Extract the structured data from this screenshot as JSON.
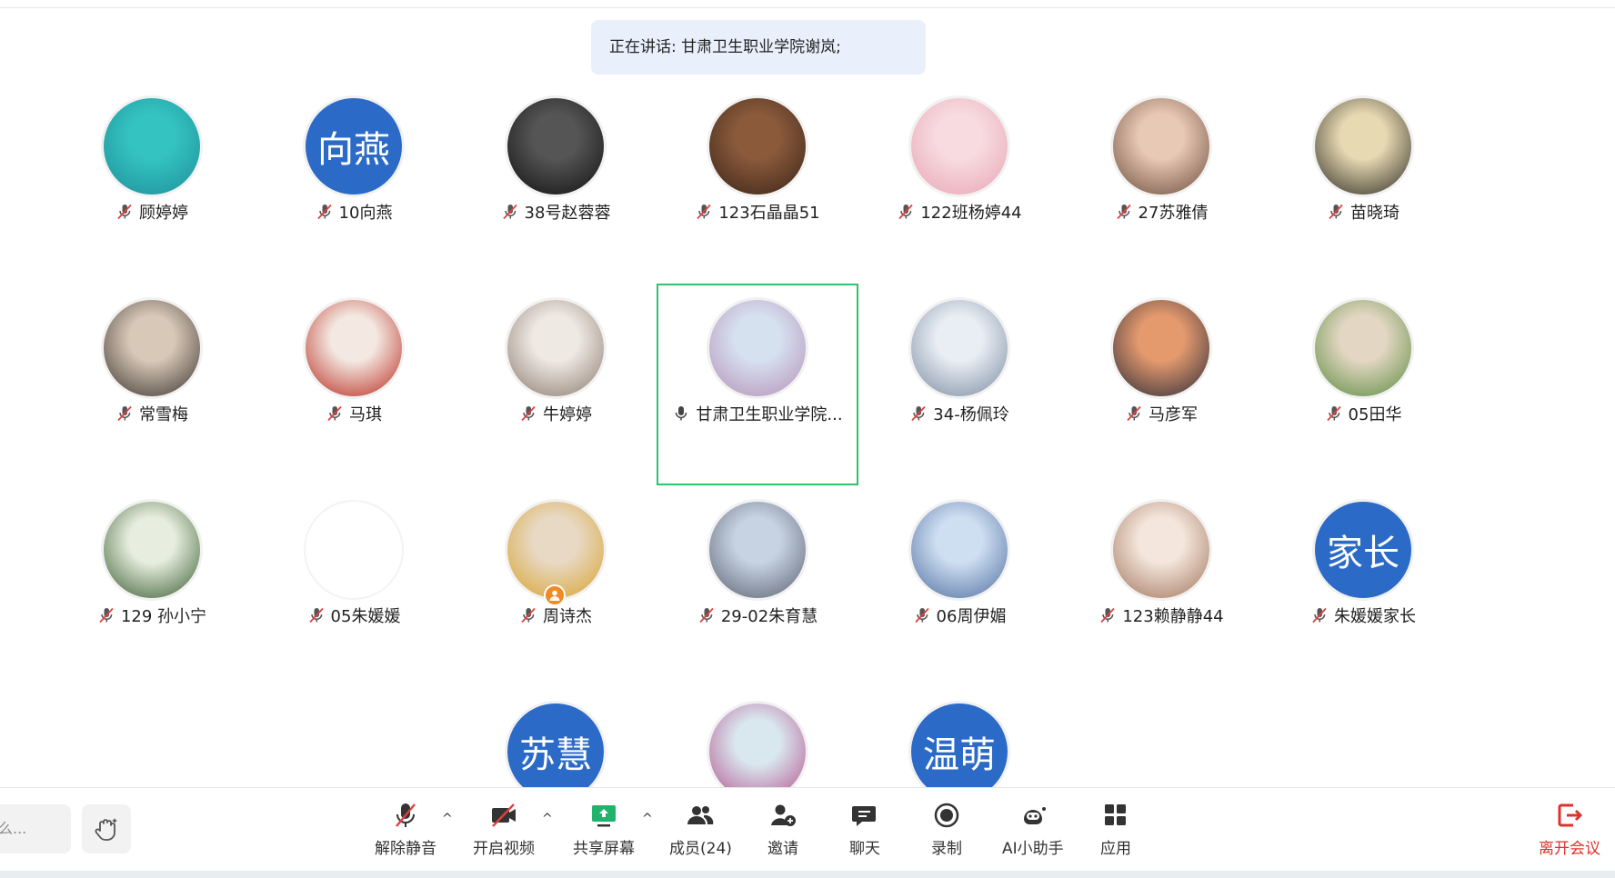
{
  "speaking_banner": "正在讲话: 甘肃卫生职业学院谢岚;",
  "participants": [
    {
      "name": "顾婷婷",
      "avatar_type": "photo",
      "colors": [
        "#34c3c0",
        "#1f8e9a"
      ],
      "muted": true
    },
    {
      "name": "10向燕",
      "avatar_type": "text",
      "avatar_text": "向燕",
      "muted": true
    },
    {
      "name": "38号赵蓉蓉",
      "avatar_type": "photo",
      "colors": [
        "#555555",
        "#111111"
      ],
      "muted": true
    },
    {
      "name": "123石晶晶51",
      "avatar_type": "photo",
      "colors": [
        "#8a5a3b",
        "#3a2418"
      ],
      "muted": true
    },
    {
      "name": "122班杨婷44",
      "avatar_type": "photo",
      "colors": [
        "#f7dbe0",
        "#e8a4b4"
      ],
      "muted": true
    },
    {
      "name": "27苏雅倩",
      "avatar_type": "photo",
      "colors": [
        "#e8c9b5",
        "#6b4b3a"
      ],
      "muted": true
    },
    {
      "name": "苗晓琦",
      "avatar_type": "photo",
      "colors": [
        "#e7d9b2",
        "#2d2a22"
      ],
      "muted": true
    },
    {
      "name": "常雪梅",
      "avatar_type": "photo",
      "colors": [
        "#d8c8b8",
        "#3a332d"
      ],
      "muted": true
    },
    {
      "name": "马琪",
      "avatar_type": "photo",
      "colors": [
        "#f3e9e2",
        "#b8261a"
      ],
      "muted": true
    },
    {
      "name": "牛婷婷",
      "avatar_type": "photo",
      "colors": [
        "#efe9e4",
        "#8a7a6c"
      ],
      "muted": true
    },
    {
      "name": "甘肃卫生职业学院...",
      "avatar_type": "photo",
      "colors": [
        "#d6e1ef",
        "#b58fb8"
      ],
      "muted": false,
      "highlighted": true
    },
    {
      "name": "34-杨佩玲",
      "avatar_type": "photo",
      "colors": [
        "#e9eef4",
        "#7a8ba0"
      ],
      "muted": true
    },
    {
      "name": "马彦军",
      "avatar_type": "photo",
      "colors": [
        "#e59a6e",
        "#2a2a38"
      ],
      "muted": true
    },
    {
      "name": "05田华",
      "avatar_type": "photo",
      "colors": [
        "#e3d7c4",
        "#5a8a3c"
      ],
      "muted": true
    },
    {
      "name": "129 孙小宁",
      "avatar_type": "photo",
      "colors": [
        "#e8eedf",
        "#355b2e"
      ],
      "muted": true
    },
    {
      "name": "05朱媛媛",
      "avatar_type": "blank",
      "muted": true
    },
    {
      "name": "周诗杰",
      "avatar_type": "photo",
      "colors": [
        "#e8d9c4",
        "#d8a12a"
      ],
      "muted": true,
      "user_badge": true
    },
    {
      "name": "29-02朱育慧",
      "avatar_type": "photo",
      "colors": [
        "#c7d3e3",
        "#5b6170"
      ],
      "muted": true
    },
    {
      "name": "06周伊媚",
      "avatar_type": "photo",
      "colors": [
        "#cfdff2",
        "#4d6da0"
      ],
      "muted": true
    },
    {
      "name": "123赖静静44",
      "avatar_type": "photo",
      "colors": [
        "#f4e6dc",
        "#a0735a"
      ],
      "muted": true
    },
    {
      "name": "朱媛媛家长",
      "avatar_type": "text",
      "avatar_text": "家长",
      "muted": true
    },
    {
      "name": "",
      "avatar_type": "text",
      "avatar_text": "苏慧",
      "muted": true
    },
    {
      "name": "",
      "avatar_type": "photo",
      "colors": [
        "#d9e7ef",
        "#b24f8a"
      ],
      "muted": true
    },
    {
      "name": "",
      "avatar_type": "text",
      "avatar_text": "温萌",
      "muted": true
    }
  ],
  "toolbar": {
    "chat_placeholder": "说点什么...",
    "chat_visible": "么...",
    "unmute": "解除静音",
    "start_video": "开启视频",
    "share_screen": "共享屏幕",
    "members": "成员(24)",
    "invite": "邀请",
    "chat": "聊天",
    "record": "录制",
    "ai_assistant": "AI小助手",
    "apps": "应用",
    "leave": "离开会议",
    "caret": "^"
  },
  "colors": {
    "accent_blue": "#2b6ac6",
    "highlight_green": "#2ec26b",
    "share_green": "#1fb36b",
    "leave_red": "#e0322d",
    "muted_red": "#e04040"
  }
}
